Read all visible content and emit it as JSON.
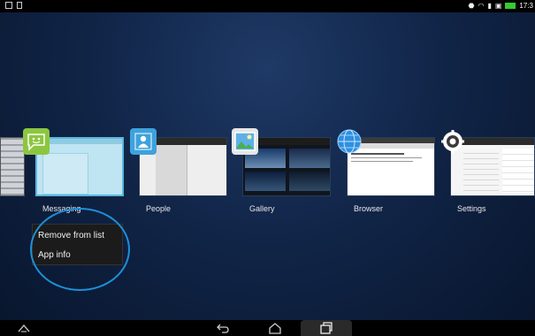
{
  "status_bar": {
    "time": "17:3",
    "left_icons": [
      "screenshot-icon",
      "file-icon"
    ],
    "right_icons": [
      "bluetooth-icon",
      "wifi-icon",
      "signal-icon",
      "notification-icon",
      "battery-icon"
    ]
  },
  "recent_apps": [
    {
      "label": "Messaging",
      "icon": "messaging-icon",
      "selected": true
    },
    {
      "label": "People",
      "icon": "people-icon",
      "selected": false
    },
    {
      "label": "Gallery",
      "icon": "gallery-icon",
      "selected": false
    },
    {
      "label": "Browser",
      "icon": "browser-icon",
      "selected": false
    },
    {
      "label": "Settings",
      "icon": "settings-icon",
      "selected": false
    }
  ],
  "context_menu": {
    "items": [
      {
        "label": "Remove from list"
      },
      {
        "label": "App info"
      }
    ]
  },
  "nav_bar": {
    "buttons": [
      "asus-menu-icon",
      "back-icon",
      "home-icon",
      "recent-apps-icon"
    ]
  },
  "colors": {
    "highlight": "#1e8fd6",
    "messaging_accent": "#8cc63f",
    "selected_thumb": "#bfe4f2"
  }
}
